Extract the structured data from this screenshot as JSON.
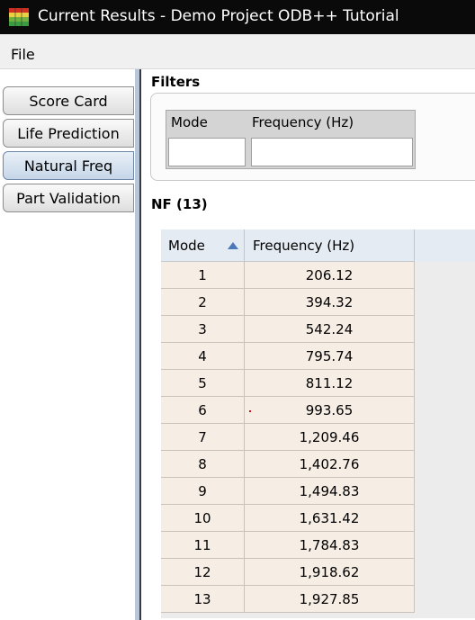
{
  "window": {
    "title": "Current Results - Demo Project ODB++ Tutorial"
  },
  "menu": {
    "file": "File"
  },
  "nav": {
    "tabs": [
      "Score Card",
      "Life Prediction",
      "Natural Freq",
      "Part Validation"
    ],
    "active": "Natural Freq"
  },
  "filters": {
    "title": "Filters",
    "mode_label": "Mode",
    "mode_value": "",
    "frequency_label": "Frequency (Hz)",
    "frequency_value": ""
  },
  "results": {
    "title": "NF (13)",
    "columns": [
      "Mode",
      "Frequency (Hz)"
    ],
    "sort_column": "Mode",
    "sort_direction": "ascending",
    "rows": [
      [
        "1",
        "206.12"
      ],
      [
        "2",
        "394.32"
      ],
      [
        "3",
        "542.24"
      ],
      [
        "4",
        "795.74"
      ],
      [
        "5",
        "811.12"
      ],
      [
        "6",
        "993.65"
      ],
      [
        "7",
        "1,209.46"
      ],
      [
        "8",
        "1,402.76"
      ],
      [
        "9",
        "1,494.83"
      ],
      [
        "10",
        "1,631.42"
      ],
      [
        "11",
        "1,784.83"
      ],
      [
        "12",
        "1,918.62"
      ],
      [
        "13",
        "1,927.85"
      ]
    ]
  },
  "colors": {
    "title_bar": "#0a0a0a",
    "row_background": "#f6ede4",
    "header_background": "#e5ebf2",
    "active_tab": "#c6d6e8"
  }
}
